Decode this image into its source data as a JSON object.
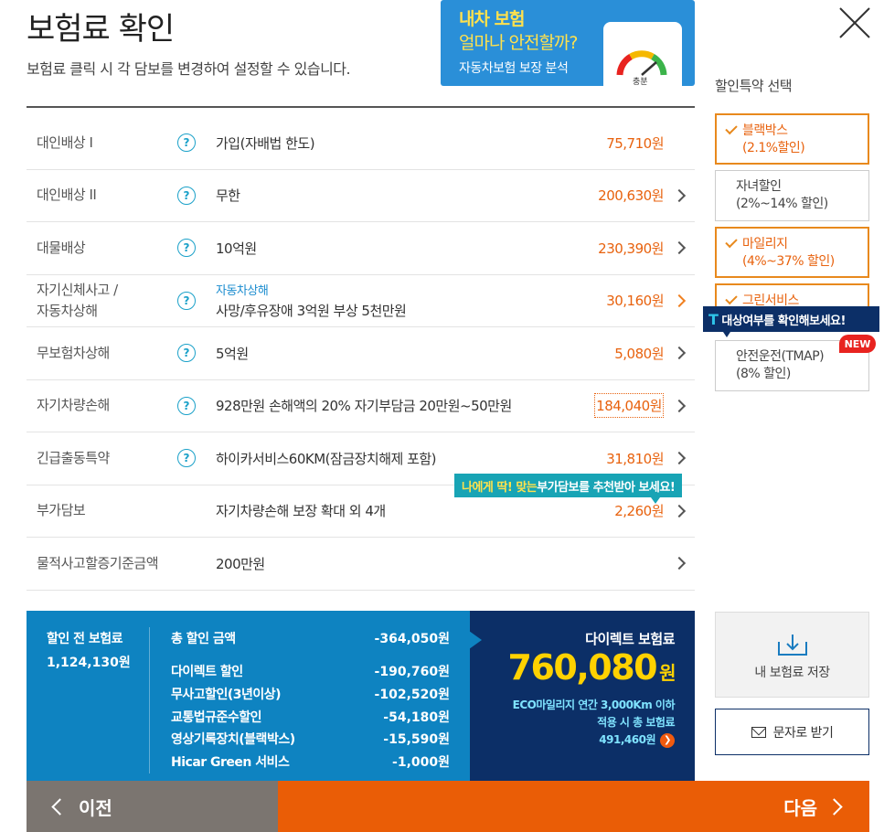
{
  "header": {
    "title": "보험료 확인",
    "subtitle": "보험료 클릭 시 각 담보를 변경하여 설정할 수 있습니다."
  },
  "banner": {
    "line1": "내차 보험",
    "line2": "얼마나 안전할까?",
    "line3": "자동차보험 보장 분석",
    "gauge_label": "충분"
  },
  "coverages": [
    {
      "label": "대인배상 I",
      "help": "?",
      "sub": "",
      "desc": "가입(자배법 한도)",
      "price": "75,710원"
    },
    {
      "label": "대인배상 II",
      "help": "?",
      "sub": "",
      "desc": "무한",
      "price": "200,630원"
    },
    {
      "label": "대물배상",
      "help": "?",
      "sub": "",
      "desc": "10억원",
      "price": "230,390원"
    },
    {
      "label": "자기신체사고 /\n자동차상해",
      "help": "?",
      "sub": "자동차상해",
      "desc": "사망/후유장애 3억원 부상 5천만원",
      "price": "30,160원"
    },
    {
      "label": "무보험차상해",
      "help": "?",
      "sub": "",
      "desc": "5억원",
      "price": "5,080원"
    },
    {
      "label": "자기차량손해",
      "help": "?",
      "sub": "",
      "desc": "928만원 손해액의 20% 자기부담금 20만원~50만원",
      "price": "184,040원"
    },
    {
      "label": "긴급출동특약",
      "help": "?",
      "sub": "",
      "desc": "하이카서비스60KM(잠금장치해제 포함)",
      "price": "31,810원"
    },
    {
      "label": "부가담보",
      "help": "",
      "sub": "",
      "desc": "자기차량손해 보장 확대 외 4개",
      "price": "2,260원"
    },
    {
      "label": "물적사고할증기준금액",
      "help": "",
      "sub": "",
      "desc": "200만원",
      "price": ""
    }
  ],
  "tip_addon": {
    "highlight": "나에게 딱! 맞는",
    "rest": " 부가담보를 추천받아 보세요!"
  },
  "side": {
    "title": "할인특약 선택",
    "options": [
      {
        "name": "블랙박스",
        "detail": "(2.1%할인)"
      },
      {
        "name": "자녀할인",
        "detail": "(2%~14% 할인)"
      },
      {
        "name": "마일리지",
        "detail": "(4%~37% 할인)"
      },
      {
        "name": "그린서비스",
        "detail": ""
      },
      {
        "name": "안전운전(TMAP)",
        "detail": "(8% 할인)"
      }
    ],
    "tooltip": "대상여부를 확인해보세요!",
    "tooltip_icon": "T",
    "new_badge": "NEW",
    "save_label": "내 보험료 저장",
    "sms_label": "문자로 받기"
  },
  "summary": {
    "pre_label": "할인 전 보험료",
    "pre_value": "1,124,130원",
    "discounts": [
      {
        "label": "총 할인 금액",
        "value": "-364,050원"
      },
      {
        "label": "다이렉트 할인",
        "value": "-190,760원"
      },
      {
        "label": "무사고할인(3년이상)",
        "value": "-102,520원"
      },
      {
        "label": "교통법규준수할인",
        "value": "-54,180원"
      },
      {
        "label": "영상기록장치(블랙박스)",
        "value": "-15,590원"
      },
      {
        "label": "Hicar Green 서비스",
        "value": "-1,000원"
      }
    ],
    "final_title": "다이렉트 보험료",
    "final_value": "760,080",
    "final_unit": "원",
    "eco_line1": "ECO마일리지 연간 3,000Km 이하",
    "eco_line2": "적용 시 총 보험료",
    "eco_value": "491,460원"
  },
  "nav": {
    "prev": "이전",
    "next": "다음"
  },
  "colors": {
    "accent": "#ea5d06",
    "blue": "#0e83c1",
    "navy": "#0c2f67",
    "price": "#e8620e"
  }
}
